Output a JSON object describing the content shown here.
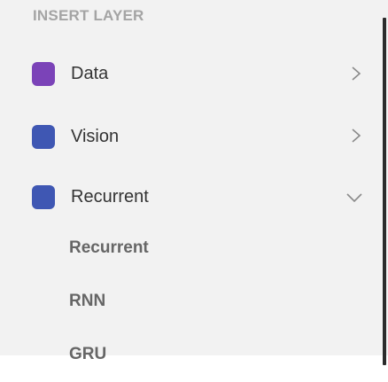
{
  "panel": {
    "title": "INSERT LAYER",
    "categories": [
      {
        "label": "Data",
        "color": "#7b43b8",
        "expanded": false
      },
      {
        "label": "Vision",
        "color": "#3f57b3",
        "expanded": false
      },
      {
        "label": "Recurrent",
        "color": "#3f57b3",
        "expanded": true
      }
    ],
    "subitems": [
      "Recurrent",
      "RNN",
      "GRU"
    ]
  }
}
